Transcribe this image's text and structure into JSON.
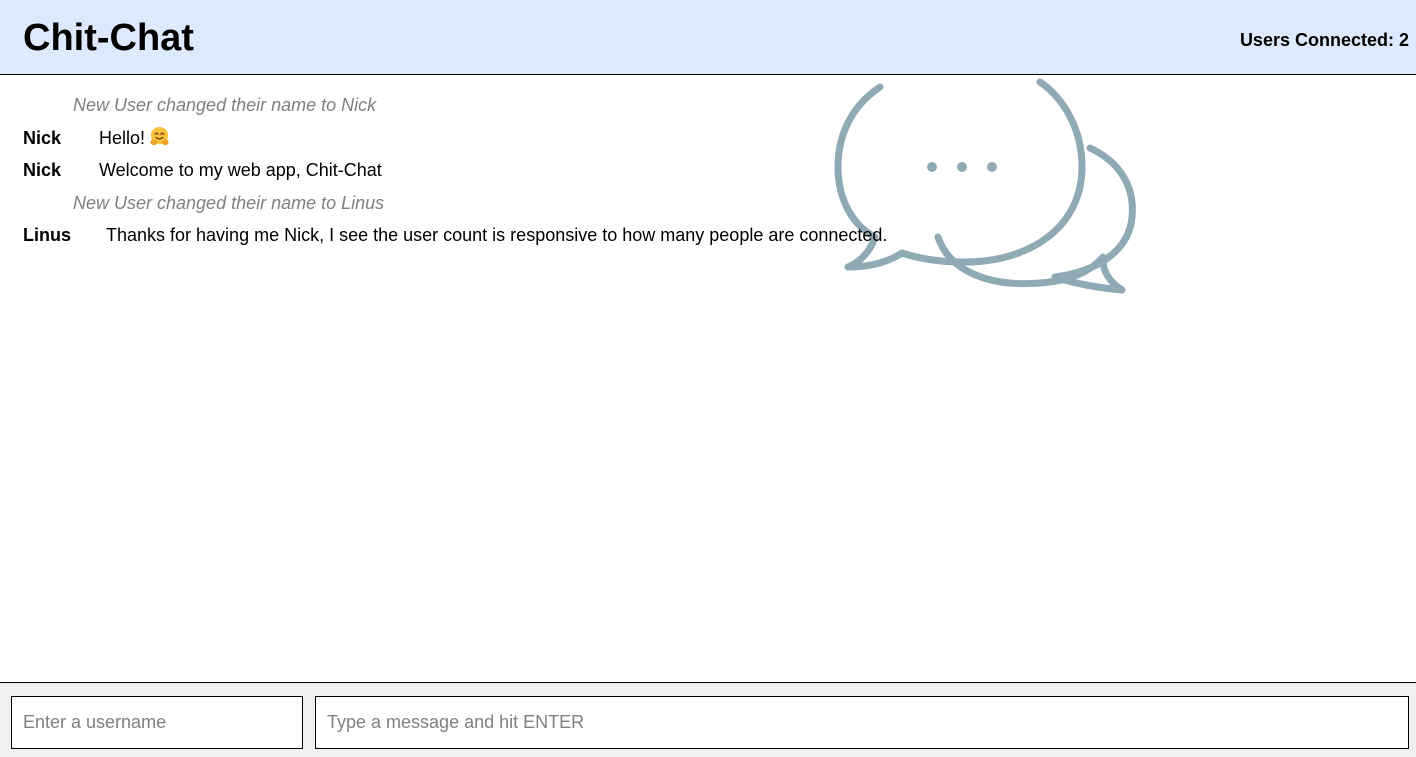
{
  "header": {
    "title": "Chit-Chat",
    "users_connected": "Users Connected: 2"
  },
  "background": {
    "icon": "chat-bubbles-icon",
    "color": "#8fa9b5"
  },
  "colors": {
    "header_bg": "#ddeafd",
    "footer_bg": "#f0f0f0",
    "system_text": "#808080"
  },
  "messages": [
    {
      "type": "system",
      "text": "New User changed their name to Nick"
    },
    {
      "type": "chat",
      "user": "Nick",
      "text": "Hello!",
      "emoji": "hugging-face-icon"
    },
    {
      "type": "chat",
      "user": "Nick",
      "text": "Welcome to my web app, Chit-Chat"
    },
    {
      "type": "system",
      "text": "New User changed their name to Linus"
    },
    {
      "type": "chat",
      "user": "Linus",
      "text": "Thanks for having me Nick, I see the user count is responsive to how many people are connected."
    }
  ],
  "footer": {
    "username_placeholder": "Enter a username",
    "username_value": "",
    "message_placeholder": "Type a message and hit ENTER",
    "message_value": ""
  }
}
